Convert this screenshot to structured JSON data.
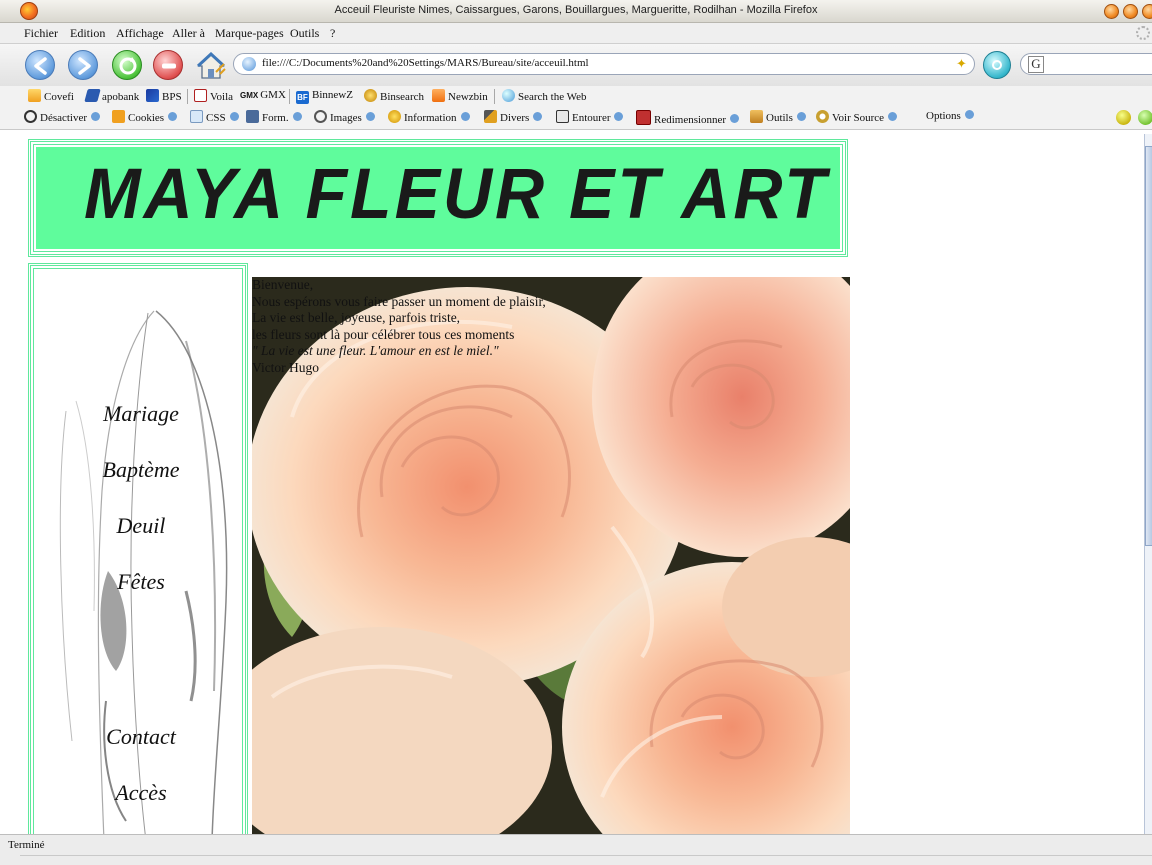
{
  "window": {
    "title": "Acceuil Fleuriste Nimes, Caissargues, Garons, Bouillargues, Margueritte, Rodilhan - Mozilla Firefox"
  },
  "menu": [
    "Fichier",
    "Edition",
    "Affichage",
    "Aller à",
    "Marque-pages",
    "Outils",
    "?"
  ],
  "address": {
    "url": "file:///C:/Documents%20and%20Settings/MARS/Bureau/site/acceuil.html"
  },
  "search": {
    "engine_letter": "G"
  },
  "bookmarks": [
    "Covefi",
    "apobank",
    "BPS",
    "Voila",
    "GMX",
    "BinnewZ",
    "Binsearch",
    "Newzbin",
    "Search the Web"
  ],
  "bookmark_icon_labels": {
    "gmx": "GMX",
    "binnewz": "BF"
  },
  "devtools": [
    "Désactiver",
    "Cookies",
    "CSS",
    "Form.",
    "Images",
    "Information",
    "Divers",
    "Entourer",
    "Redimensionner",
    "Outils",
    "Voir Source",
    "Options"
  ],
  "page": {
    "site_title": "MAYA  FLEUR  ET ART",
    "nav": [
      "Mariage",
      "Baptème",
      "Deuil",
      "Fêtes",
      "Contact",
      "Accès"
    ],
    "welcome": {
      "lines": [
        "Bienvenue,",
        "Nous espérons vous faire passer un moment de plaisir,",
        "La vie est belle, joyeuse, parfois triste,",
        "les fleurs sont là pour célébrer tous ces moments"
      ],
      "quote": "\" La vie est une fleur. L'amour en est le miel.\"",
      "author": "Victor Hugo"
    },
    "colors": {
      "accent_green": "#5ffc9c",
      "border_green": "#5fe89c"
    }
  },
  "status": {
    "text": "Terminé"
  }
}
